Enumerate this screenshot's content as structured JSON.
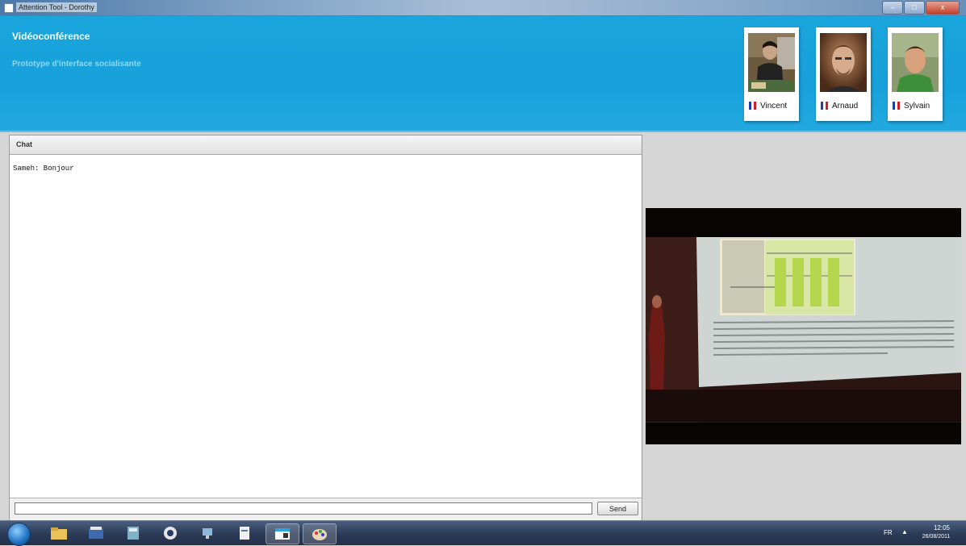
{
  "window": {
    "title": "Attention Tool - Dorothy",
    "controls": {
      "minimize": "–",
      "maximize": "□",
      "close": "x"
    }
  },
  "header": {
    "title": "Vidéoconférence",
    "subtitle": "Prototype d'interface socialisante",
    "participants": [
      {
        "name": "Vincent",
        "flag": "france-flag-icon"
      },
      {
        "name": "Arnaud",
        "flag": "france-flag-icon"
      },
      {
        "name": "Sylvain",
        "flag": "france-flag-icon"
      }
    ]
  },
  "chat": {
    "title": "Chat",
    "messages": [
      "Sameh: Bonjour"
    ],
    "input_value": "",
    "send_label": "Send"
  },
  "colors": {
    "header_blue": "#17a0da",
    "flag_blue": "#1d3fa6",
    "flag_white": "#ffffff",
    "flag_red": "#d0202b"
  },
  "taskbar": {
    "items": [
      "start-orb-icon",
      "file-explorer-icon",
      "media-library-icon",
      "calculator-icon",
      "media-player-icon",
      "network-icon",
      "document-tool-icon",
      "attention-tool-window-icon",
      "paint-icon"
    ],
    "language": "FR",
    "time": "12:05",
    "date": "26/08/2011"
  }
}
